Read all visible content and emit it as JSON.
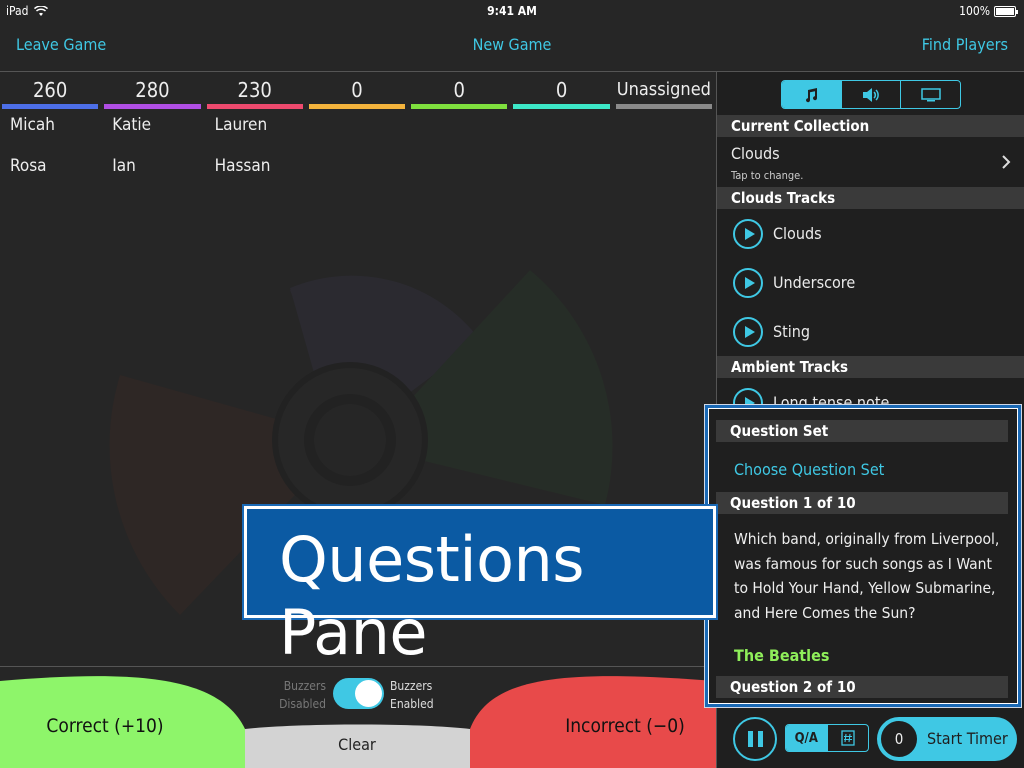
{
  "status": {
    "device": "iPad",
    "time": "9:41 AM",
    "battery": "100%"
  },
  "nav": {
    "leave": "Leave Game",
    "new_game": "New Game",
    "find": "Find Players"
  },
  "teams": [
    {
      "score": "260",
      "color": "#4d6fe8",
      "players": [
        "Micah",
        "Rosa"
      ]
    },
    {
      "score": "280",
      "color": "#b04ee4",
      "players": [
        "Katie",
        "Ian"
      ]
    },
    {
      "score": "230",
      "color": "#ee4a6e",
      "players": [
        "Lauren",
        "Hassan"
      ]
    },
    {
      "score": "0",
      "color": "#f3b33c",
      "players": []
    },
    {
      "score": "0",
      "color": "#7fe03e",
      "players": []
    },
    {
      "score": "0",
      "color": "#3de8c8",
      "players": []
    },
    {
      "score": "Unassigned",
      "color": "#8a8a8a",
      "players": []
    }
  ],
  "bottom": {
    "correct": "Correct (+10)",
    "incorrect": "Incorrect (−0)",
    "clear": "Clear",
    "buzzers_off_1": "Buzzers",
    "buzzers_off_2": "Disabled",
    "buzzers_on_1": "Buzzers",
    "buzzers_on_2": "Enabled"
  },
  "panel": {
    "collection_header": "Current Collection",
    "collection_name": "Clouds",
    "collection_hint": "Tap to change.",
    "tracks_header": "Clouds Tracks",
    "tracks": [
      "Clouds",
      "Underscore",
      "Sting"
    ],
    "ambient_header": "Ambient Tracks",
    "ambient_first": "Long tense note",
    "qa_label": "Q/A",
    "timer_count": "0",
    "timer_label": "Start Timer"
  },
  "questions": {
    "set_header": "Question Set",
    "choose": "Choose Question Set",
    "q1_header": "Question 1 of 10",
    "q1_text": "Which band, originally from Liverpool, was famous for such songs as I Want to Hold Your Hand, Yellow Submarine, and Here Comes the Sun?",
    "q1_answer": "The Beatles",
    "q2_header": "Question 2 of 10"
  },
  "callout": "Questions Pane",
  "colors": {
    "accent": "#3fc8e4",
    "correct": "#8ef56a",
    "incorrect": "#e84a4a",
    "callout": "#0b5aa3"
  }
}
